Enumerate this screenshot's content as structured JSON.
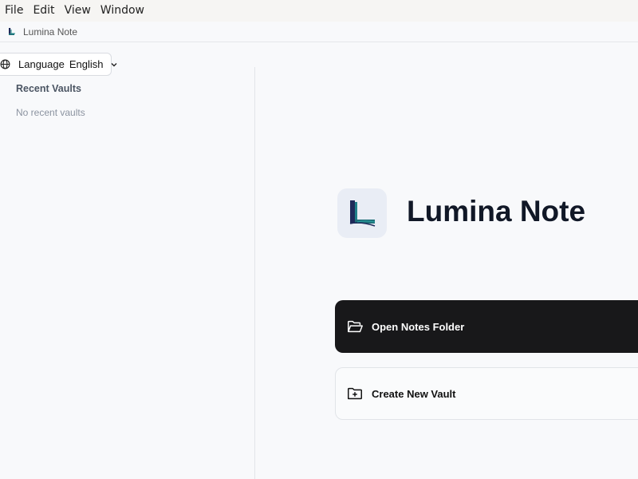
{
  "menubar": {
    "items": [
      "File",
      "Edit",
      "View",
      "Window"
    ]
  },
  "window": {
    "title": "Lumina Note",
    "icon": "lumina-logo-icon"
  },
  "sidebar": {
    "language": {
      "label": "Language",
      "value": "English",
      "icon": "globe-icon"
    },
    "recent_vaults": {
      "title": "Recent Vaults",
      "empty_text": "No recent vaults"
    }
  },
  "main": {
    "app_name": "Lumina Note",
    "open_button": {
      "label": "Open Notes Folder",
      "icon": "folder-open-icon"
    },
    "create_button": {
      "label": "Create New Vault",
      "icon": "folder-plus-icon"
    }
  },
  "colors": {
    "background": "#f8f9fb",
    "primary_button": "#18181a",
    "logo_teal": "#1f6f78",
    "logo_navy": "#1e2a5a"
  }
}
